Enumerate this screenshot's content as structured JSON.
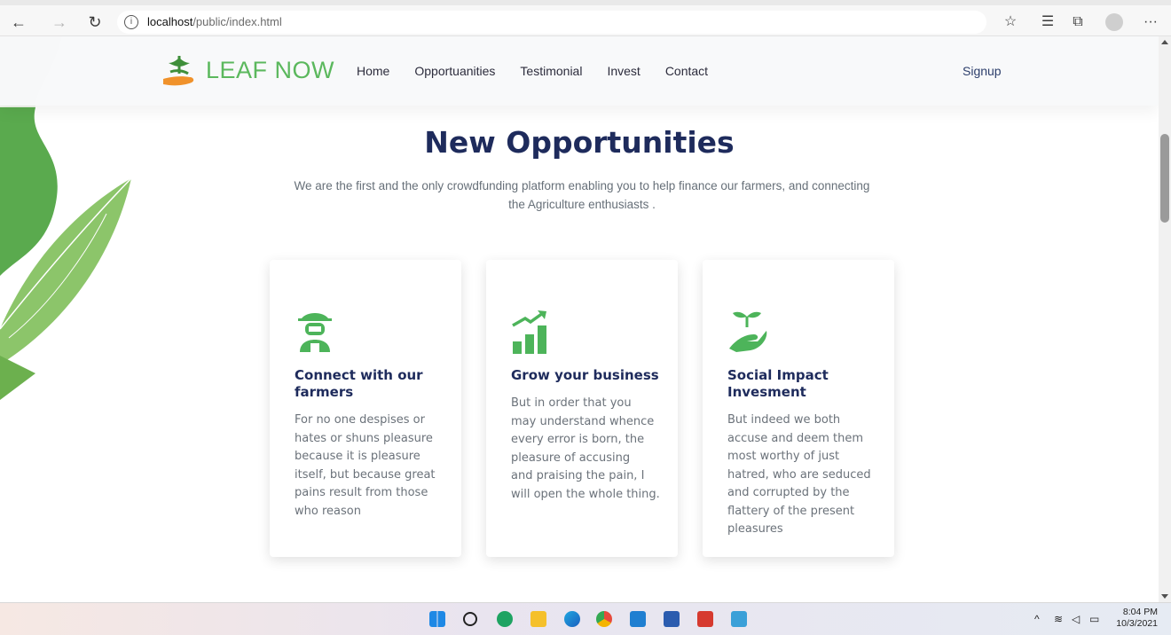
{
  "browser": {
    "url_host": "localhost",
    "url_path": "/public/index.html",
    "back_glyph": "←",
    "forward_glyph": "→",
    "reload_glyph": "↻",
    "info_glyph": "i",
    "icons": [
      "star-add-icon",
      "favorites-icon",
      "collections-icon",
      "profile-icon",
      "more-icon"
    ]
  },
  "site": {
    "brand": "LEAF NOW",
    "brand_color": "#5bb85d",
    "nav": [
      "Home",
      "Opportuanities",
      "Testimonial",
      "Invest",
      "Contact"
    ],
    "signup": "Signup"
  },
  "hero": {
    "title": "New Opportunities",
    "subtitle_line1": "We are the first and the only crowdfunding platform enabling you to help finance our farmers, and connecting",
    "subtitle_line2": "the Agriculture enthusiasts ."
  },
  "cards": [
    {
      "icon": "farmer-icon",
      "title_line1": "Connect with our",
      "title_line2": "farmers",
      "lines": [
        "For no one despises or",
        "hates or shuns pleasure",
        "because it is pleasure",
        "itself, but because great",
        "pains result from those",
        "who reason"
      ]
    },
    {
      "icon": "growth-chart-icon",
      "title_line1": "Grow your business",
      "title_line2": "",
      "lines": [
        "But in order that you",
        "may understand whence",
        "every error is born, the",
        "pleasure of accusing",
        "and praising the pain, I",
        "will open the whole thing."
      ]
    },
    {
      "icon": "plant-hand-icon",
      "title_line1": "Social Impact",
      "title_line2": "Invesment",
      "lines": [
        "But indeed we both",
        "accuse and deem them",
        "most worthy of just",
        "hatred, who are seduced",
        "and corrupted by the",
        "flattery of the present",
        "pleasures"
      ]
    }
  ],
  "taskbar": {
    "apps": [
      "windows-start-icon",
      "search-icon",
      "skype-icon",
      "file-explorer-icon",
      "edge-icon",
      "chrome-icon",
      "vscode-icon",
      "word-icon",
      "pdf-icon",
      "notepad-icon"
    ],
    "time": "8:04 PM",
    "date": "10/3/2021"
  },
  "colors": {
    "accent_green": "#5bb85d",
    "title_navy": "#1e2b5c"
  }
}
